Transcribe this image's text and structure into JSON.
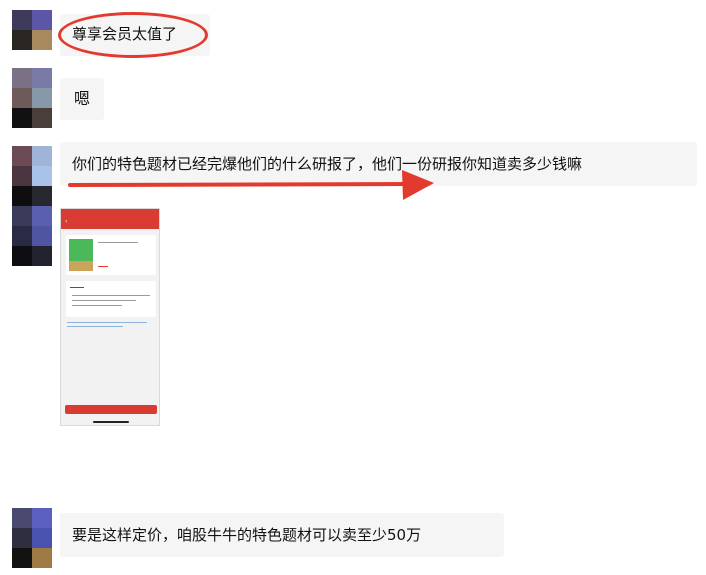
{
  "colors": {
    "background": "#ffffff",
    "bubble": "#f5f5f5",
    "annotation_red": "#e23a2e",
    "phone_header_red": "#d93a32"
  },
  "messages": [
    {
      "id": "m1",
      "type": "text",
      "text": "尊享会员太值了",
      "annotation": "red-oval-highlight"
    },
    {
      "id": "m2",
      "type": "text",
      "text": "嗯"
    },
    {
      "id": "m3",
      "type": "text",
      "text": "你们的特色题材已经完爆他们的什么研报了，他们一份研报你知道卖多少钱嘛",
      "annotation": "red-arrow"
    },
    {
      "id": "m4",
      "type": "image",
      "content": "app-screenshot"
    },
    {
      "id": "m5",
      "type": "text",
      "text": "要是这样定价，咱股牛牛的特色题材可以卖至少50万"
    }
  ]
}
